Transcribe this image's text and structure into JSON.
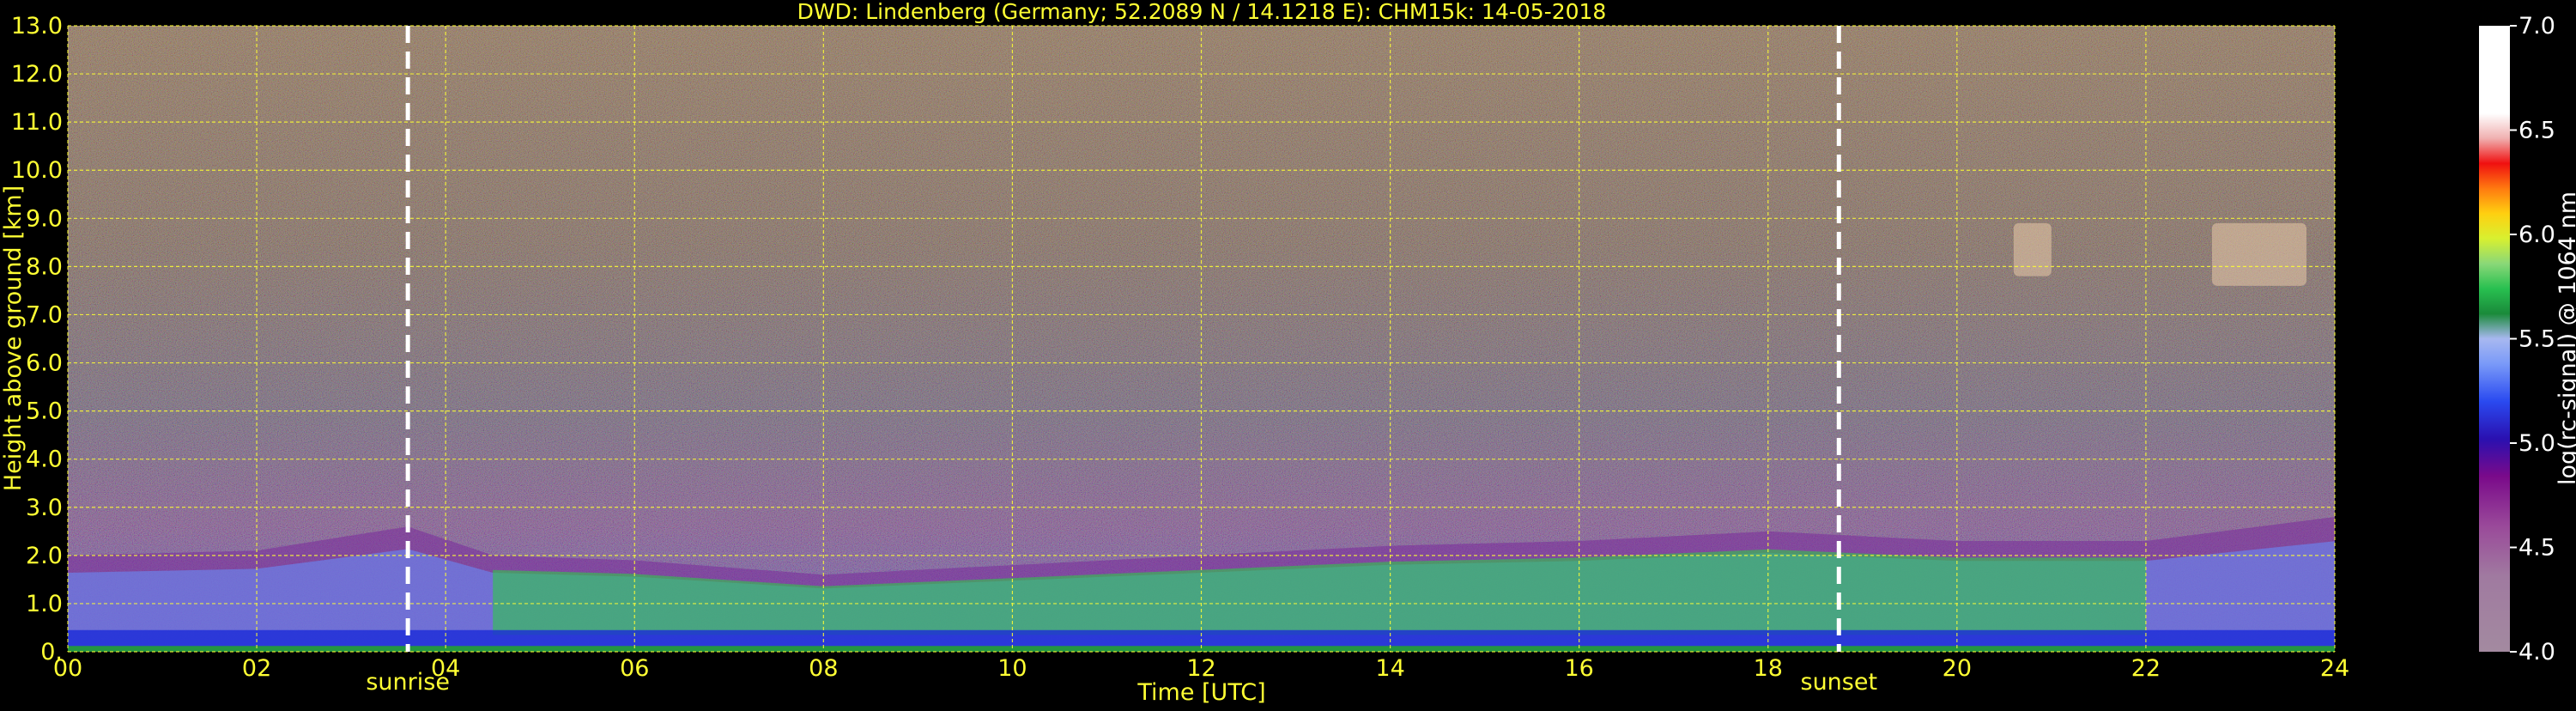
{
  "chart_data": {
    "type": "heatmap",
    "title": "DWD: Lindenberg (Germany; 52.2089 N / 14.1218 E):    CHM15k: 14-05-2018",
    "xlabel": "Time [UTC]",
    "ylabel": "Height above ground [km]",
    "xlim": [
      0,
      24
    ],
    "ylim": [
      0,
      13
    ],
    "x_ticks": [
      "00",
      "02",
      "04",
      "06",
      "08",
      "10",
      "12",
      "14",
      "16",
      "18",
      "20",
      "22",
      "24"
    ],
    "y_ticks": [
      "0.",
      "1.0",
      "2.0",
      "3.0",
      "4.0",
      "5.0",
      "6.0",
      "7.0",
      "8.0",
      "9.0",
      "10.0",
      "11.0",
      "12.0",
      "13.0"
    ],
    "grid": true,
    "annotations": [
      {
        "label": "sunrise",
        "x": 3.6
      },
      {
        "label": "sunset",
        "x": 18.75
      }
    ],
    "colorbar": {
      "label": "log(rc-signal) @ 1064 nm",
      "range": [
        4.0,
        7.0
      ],
      "ticks": [
        "4.0",
        "4.5",
        "5.0",
        "5.5",
        "6.0",
        "6.5",
        "7.0"
      ]
    },
    "boundary_layer_top_km": [
      {
        "x": 0,
        "y": 2.0
      },
      {
        "x": 2,
        "y": 2.1
      },
      {
        "x": 3.6,
        "y": 2.6
      },
      {
        "x": 4.5,
        "y": 2.0
      },
      {
        "x": 6,
        "y": 1.9
      },
      {
        "x": 8,
        "y": 1.6
      },
      {
        "x": 10,
        "y": 1.8
      },
      {
        "x": 12,
        "y": 2.0
      },
      {
        "x": 14,
        "y": 2.2
      },
      {
        "x": 16,
        "y": 2.3
      },
      {
        "x": 18,
        "y": 2.5
      },
      {
        "x": 20,
        "y": 2.3
      },
      {
        "x": 22,
        "y": 2.3
      },
      {
        "x": 24,
        "y": 2.8
      }
    ],
    "cirrus_features": [
      {
        "x_start": 20.6,
        "x_end": 21.0,
        "y_low": 7.8,
        "y_high": 8.9
      },
      {
        "x_start": 22.7,
        "x_end": 23.7,
        "y_low": 7.6,
        "y_high": 8.9
      }
    ]
  },
  "colors": {
    "axis_text": "#ffff33",
    "colorbar_text": "#ffffff",
    "grid": "#ffff33",
    "sun_line": "#ffffff"
  }
}
